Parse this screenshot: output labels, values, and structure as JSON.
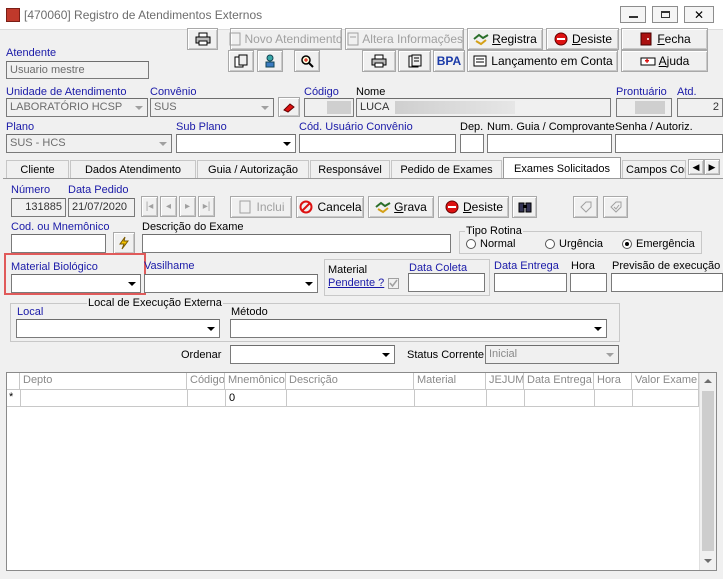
{
  "window": {
    "title": "[470060]  Registro de Atendimentos Externos"
  },
  "toolbar": {
    "novo_atendimento": "Novo Atendimento",
    "altera_informacoes": "Altera Informações",
    "registra": "Registra",
    "desiste": "Desiste",
    "fecha": "Fecha",
    "bpa": "BPA",
    "lancamento_em_conta": "Lançamento em Conta",
    "ajuda": "Ajuda"
  },
  "header": {
    "atendente_label": "Atendente",
    "atendente_value": "Usuario mestre",
    "unidade_label": "Unidade de Atendimento",
    "unidade_value": "LABORATÓRIO HCSP",
    "convenio_label": "Convênio",
    "convenio_value": "SUS",
    "codigo_label": "Código",
    "nome_label": "Nome",
    "nome_value": "LUCA",
    "prontuario_label": "Prontuário",
    "atd_label": "Atd.",
    "atd_value": "2",
    "plano_label": "Plano",
    "plano_value": "SUS - HCS",
    "subplano_label": "Sub Plano",
    "cod_usuario_label": "Cód. Usuário Convênio",
    "dep_label": "Dep.",
    "num_guia_label": "Num. Guia / Comprovante",
    "senha_label": "Senha / Autoriz."
  },
  "tabs": [
    {
      "label": "Cliente"
    },
    {
      "label": "Dados Atendimento"
    },
    {
      "label": "Guia / Autorização"
    },
    {
      "label": "Responsável"
    },
    {
      "label": "Pedido de Exames"
    },
    {
      "label": "Exames Solicitados"
    },
    {
      "label": "Campos Com"
    }
  ],
  "exames": {
    "numero_label": "Número",
    "numero_value": "131885",
    "data_pedido_label": "Data Pedido",
    "data_pedido_value": "21/07/2020",
    "inclui": "Inclui",
    "cancela": "Cancela",
    "grava": "Grava",
    "desiste": "Desiste",
    "cod_label": "Cod. ou Mnemônico",
    "descricao_label": "Descrição do Exame",
    "tipo_rotina_label": "Tipo Rotina",
    "rotina_options": [
      {
        "label": "Normal",
        "selected": false
      },
      {
        "label": "Urgência",
        "selected": false
      },
      {
        "label": "Emergência",
        "selected": true
      }
    ],
    "material_label": "Material Biológico",
    "vasilhame_label": "Vasilhame",
    "material_pendente_line1": "Material",
    "material_pendente_line2": "Pendente ?",
    "data_coleta_label": "Data Coleta",
    "data_entrega_label": "Data Entrega",
    "hora_label": "Hora",
    "previsao_label": "Previsão de execução",
    "local_exec_label": "Local de Execução Externa",
    "local_label": "Local",
    "metodo_label": "Método",
    "ordenar_label": "Ordenar",
    "status_label": "Status Corrente:",
    "status_value": "Inicial"
  },
  "grid": {
    "columns": [
      "Depto",
      "Código",
      "Mnemônico",
      "Descrição",
      "Material",
      "JEJUM",
      "Data Entrega",
      "Hora",
      "Valor Exame"
    ],
    "row_marker": "*",
    "row_values": [
      "",
      "",
      "0",
      "",
      "",
      "",
      "",
      "",
      ""
    ]
  },
  "colors": {
    "highlight": "#e05a5a",
    "label_blue": "#1a1aa8"
  }
}
